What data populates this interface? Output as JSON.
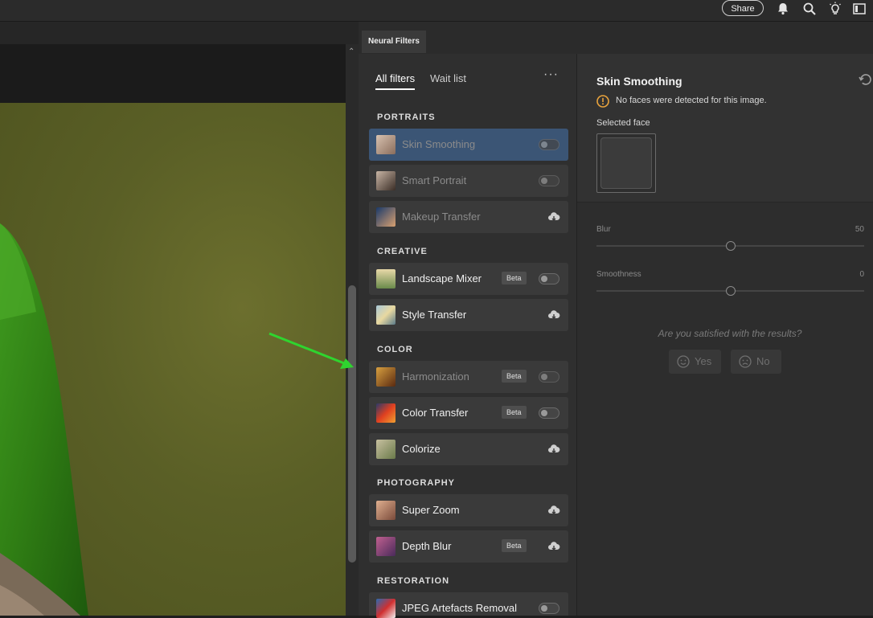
{
  "topbar": {
    "share_label": "Share",
    "icons": [
      "bell-icon",
      "search-icon",
      "lightbulb-icon",
      "panel-icon"
    ]
  },
  "panel": {
    "tab_title": "Neural Filters",
    "tabs": {
      "all": "All filters",
      "wait": "Wait list"
    },
    "more_label": "···"
  },
  "sections": [
    {
      "title": "PORTRAITS",
      "items": [
        {
          "label": "Skin Smoothing",
          "control": "toggle",
          "active": true,
          "dim": true
        },
        {
          "label": "Smart Portrait",
          "control": "toggle",
          "dim": true
        },
        {
          "label": "Makeup Transfer",
          "control": "cloud",
          "dim": true
        }
      ]
    },
    {
      "title": "CREATIVE",
      "items": [
        {
          "label": "Landscape Mixer",
          "badge": "Beta",
          "control": "toggle"
        },
        {
          "label": "Style Transfer",
          "control": "cloud"
        }
      ]
    },
    {
      "title": "COLOR",
      "items": [
        {
          "label": "Harmonization",
          "badge": "Beta",
          "control": "toggle",
          "dim": true
        },
        {
          "label": "Color Transfer",
          "badge": "Beta",
          "control": "toggle"
        },
        {
          "label": "Colorize",
          "control": "cloud"
        }
      ]
    },
    {
      "title": "PHOTOGRAPHY",
      "items": [
        {
          "label": "Super Zoom",
          "control": "cloud"
        },
        {
          "label": "Depth Blur",
          "badge": "Beta",
          "control": "cloud"
        }
      ]
    },
    {
      "title": "RESTORATION",
      "items": [
        {
          "label": "JPEG Artefacts Removal",
          "control": "toggle"
        }
      ]
    }
  ],
  "settings": {
    "title": "Skin Smoothing",
    "warning": "No faces were detected for this image.",
    "selected_face_label": "Selected face",
    "sliders": [
      {
        "label": "Blur",
        "value": "50",
        "fraction": 0.5
      },
      {
        "label": "Smoothness",
        "value": "0",
        "fraction": 0.5
      }
    ],
    "question": "Are you satisfied with the results?",
    "yes_label": "Yes",
    "no_label": "No"
  },
  "colors": {
    "accent_active": "#3b5575",
    "warning": "#e8a33d",
    "annotation_arrow": "#2fd42f"
  }
}
